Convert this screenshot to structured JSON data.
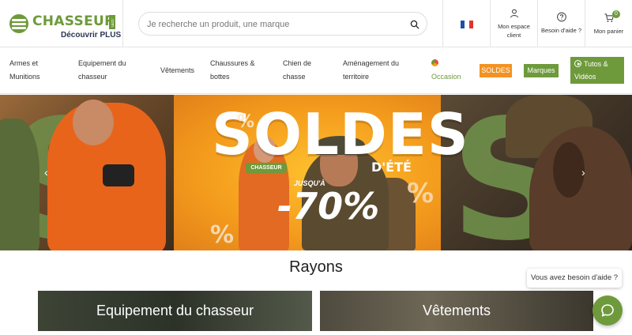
{
  "header": {
    "logo_text": "CHASSEUR",
    "logo_dotcom": ".com",
    "logo_sub_prefix": "Découvrir",
    "logo_sub_brand": "PLUS",
    "search_placeholder": "Je recherche un produit, une marque",
    "language_flag": "fr",
    "account_label": "Mon espace client",
    "help_label": "Besoin d'aide ?",
    "cart_label": "Mon panier",
    "cart_count": "0"
  },
  "nav": {
    "items": [
      {
        "label_line1": "Armes et",
        "label_line2": "Munitions"
      },
      {
        "label_line1": "Equipement du",
        "label_line2": "chasseur"
      },
      {
        "label_line1": "Vêtements",
        "label_line2": ""
      },
      {
        "label_line1": "Chaussures &",
        "label_line2": "bottes"
      },
      {
        "label_line1": "Chien de",
        "label_line2": "chasse"
      },
      {
        "label_line1": "Aménagement du",
        "label_line2": "territoire"
      }
    ],
    "occasion_label": "Occasion",
    "soldes_label": "SOLDES",
    "marques_label": "Marques",
    "tutos_line1": "Tutos &",
    "tutos_line2": "Vidéos"
  },
  "banner": {
    "title": "SOLDES",
    "subtitle": "D'ÉTÉ",
    "brand_pill": "CHASSEUR",
    "jusqua": "JUSQU'À",
    "discount": "-70%",
    "deco_percent": "%"
  },
  "rayons": {
    "title": "Rayons",
    "tiles": [
      {
        "label": "Equipement du chasseur"
      },
      {
        "label": "Vêtements"
      }
    ]
  },
  "chat": {
    "help_text": "Vous avez besoin d'aide ?"
  },
  "colors": {
    "brand_green": "#6e9a3b",
    "soldes_orange": "#f39221",
    "banner_orange": "#f0a01e"
  }
}
